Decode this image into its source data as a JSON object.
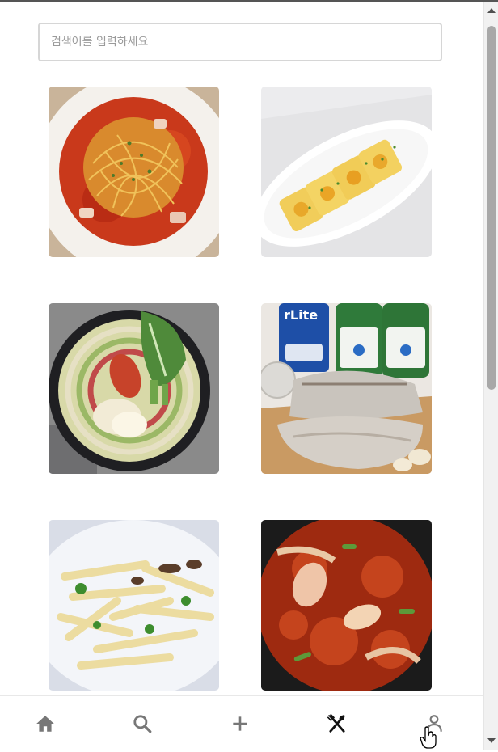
{
  "search": {
    "placeholder": "검색어를 입력하세요",
    "value": ""
  },
  "feed": {
    "posts": [
      {
        "icon": "tomato-pasta-photo"
      },
      {
        "icon": "egg-roll-photo"
      },
      {
        "icon": "hotpot-photo"
      },
      {
        "icon": "boiled-pork-soju-photo"
      },
      {
        "icon": "stir-fried-potato-photo"
      },
      {
        "icon": "spicy-stir-fry-photo"
      }
    ]
  },
  "nav": {
    "items": [
      {
        "icon": "home-icon"
      },
      {
        "icon": "search-icon"
      },
      {
        "icon": "plus-icon"
      },
      {
        "icon": "fork-spoon-icon",
        "active": true
      },
      {
        "icon": "person-icon"
      }
    ],
    "active_color": "#111111",
    "inactive_color": "#777777"
  }
}
